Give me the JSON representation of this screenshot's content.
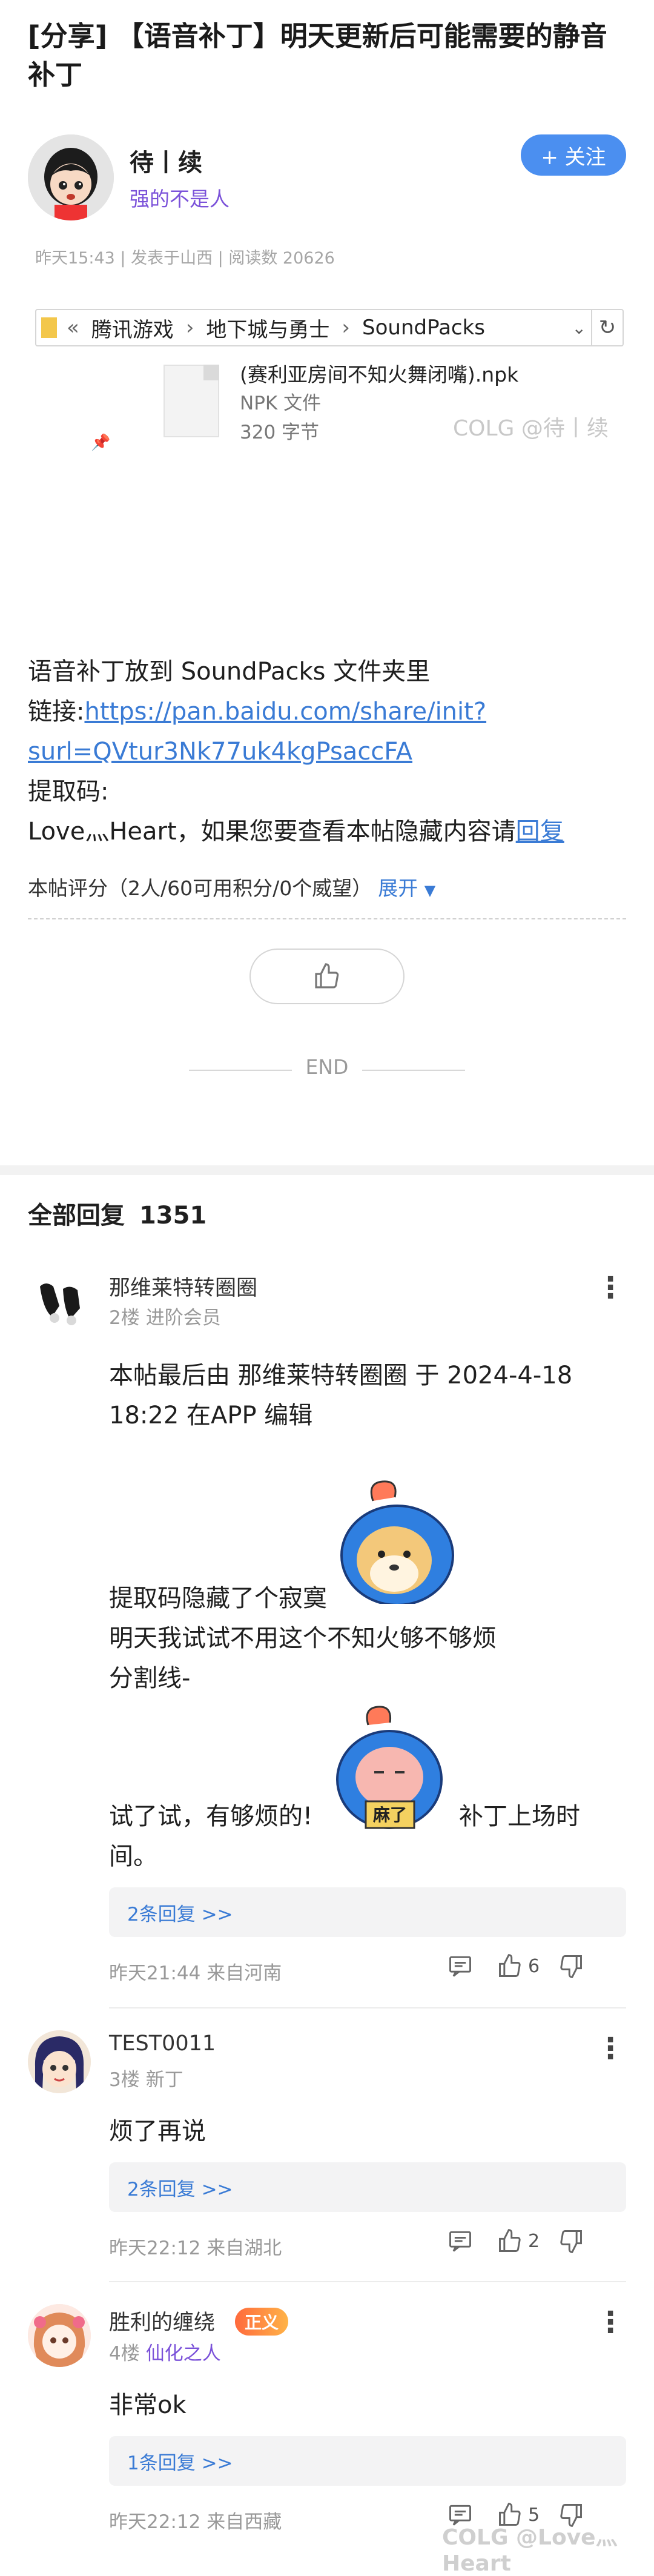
{
  "post": {
    "title": "[分享] 【语音补丁】明天更新后可能需要的静音补丁",
    "author_name": "待丨续",
    "author_tag": "强的不是人",
    "follow_label": "+ 关注",
    "meta": "昨天15:43 | 发表于山西 | 阅读数 20626",
    "body_line1": "语音补丁放到 SoundPacks 文件夹里",
    "body_link_prefix": "链接:",
    "body_link_1": "https://pan.baidu.com/share/init?",
    "body_link_2": "surl=QVtur3Nk77uk4kgPsaccFA",
    "body_code_label": "提取码:",
    "body_code": "Love灬Heart，如果您要查看本帖隐藏内容请",
    "body_reply_link": "回复",
    "rating": "本帖评分（2人/60可用积分/0个威望）",
    "rating_expand": "展开",
    "end_label": "END"
  },
  "explorer": {
    "path": [
      "«",
      "腾讯游戏",
      "›",
      "地下城与勇士",
      "›",
      "SoundPacks"
    ],
    "file_name": "(赛利亚房间不知火舞闭嘴).npk",
    "file_type": "NPK 文件",
    "file_size": "320 字节",
    "watermark": "COLG @待丨续"
  },
  "replies_header": {
    "label": "全部回复",
    "count": "1351"
  },
  "replies": [
    {
      "name": "那维莱特转圈圈",
      "floor": "2楼",
      "level": "进阶会员",
      "text1": "本帖最后由 那维莱特转圈圈 于 2024-4-18",
      "text2": "18:22 在APP 编辑",
      "text3": "提取码隐藏了个寂寞",
      "text4": "明天我试试不用这个不知火够不够烦",
      "text5": "分割线-",
      "text6a": "试了试，有够烦的!",
      "text6b": "补丁上场时",
      "text7": "间。",
      "sub_replies": "2条回复 >>",
      "time": "昨天21:44 来自河南",
      "likes": "6"
    },
    {
      "name": "TEST0011",
      "floor": "3楼",
      "level": "新丁",
      "text1": "烦了再说",
      "sub_replies": "2条回复 >>",
      "time": "昨天22:12 来自湖北",
      "likes": "2"
    },
    {
      "name": "胜利的缠绕",
      "badge": "正义",
      "floor": "4楼",
      "level": "仙化之人",
      "text1": "非常ok",
      "sub_replies": "1条回复 >>",
      "time": "昨天22:12 来自西藏",
      "likes": "5"
    }
  ],
  "sticker_labels": {
    "sticker2": "麻了"
  },
  "footer_watermark": "COLG @Love灬Heart",
  "colors": {
    "accent_blue": "#4b8ff0",
    "link_blue": "#3a7bd5",
    "purple_tag": "#7b52d9"
  }
}
